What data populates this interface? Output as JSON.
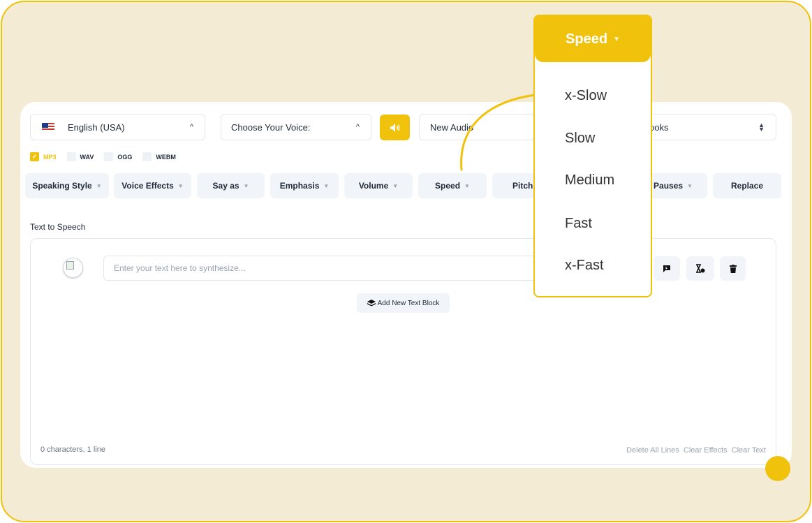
{
  "colors": {
    "accent": "#f0c20c",
    "frame_bg": "#f3ebd3",
    "toolbar_btn": "#f1f4f8"
  },
  "top_bar": {
    "language": "English (USA)",
    "voice_placeholder": "Choose Your Voice:",
    "audio_name": "New Audio",
    "category_partial": "ooks"
  },
  "formats": [
    "MP3",
    "WAV",
    "OGG",
    "WEBM"
  ],
  "toolbar": {
    "speaking_style": "Speaking Style",
    "voice_effects": "Voice Effects",
    "say_as": "Say as",
    "emphasis": "Emphasis",
    "volume": "Volume",
    "speed": "Speed",
    "pitch": "Pitch",
    "pauses": "Pauses",
    "replace": "Replace"
  },
  "editor": {
    "title": "Text to Speech",
    "input_placeholder": "Enter your text here to synthesize...",
    "add_block": "Add New Text Block",
    "status": "0 characters, 1 line",
    "delete_all": "Delete All Lines",
    "clear_effects": "Clear Effects",
    "clear_text": "Clear Text"
  },
  "speed_menu": {
    "title": "Speed",
    "options": [
      "x-Slow",
      "Slow",
      "Medium",
      "Fast",
      "x-Fast"
    ],
    "highlighted": "x-Slow"
  }
}
